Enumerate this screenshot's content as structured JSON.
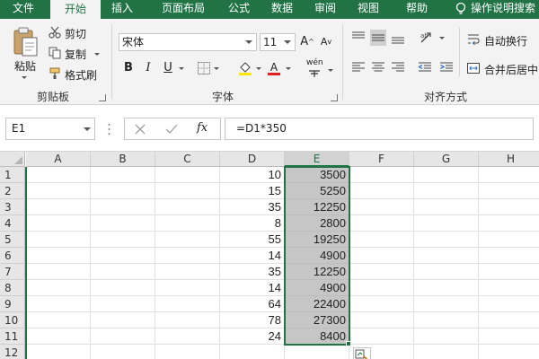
{
  "tabs": [
    "文件",
    "开始",
    "插入",
    "页面布局",
    "公式",
    "数据",
    "审阅",
    "视图",
    "帮助",
    "操作说明搜索"
  ],
  "active_tab": "开始",
  "clipboard": {
    "paste": "粘贴",
    "cut": "剪切",
    "copy": "复制",
    "format_painter": "格式刷",
    "group_label": "剪贴板"
  },
  "font": {
    "name": "宋体",
    "size": "11",
    "bold": "B",
    "italic": "I",
    "underline": "U",
    "phonetic": "wén",
    "group_label": "字体"
  },
  "alignment": {
    "wrap_text": "自动换行",
    "merge_center": "合并后居中",
    "group_label": "对齐方式"
  },
  "formula_bar": {
    "name_box": "E1",
    "fx": "fx",
    "formula": "=D1*350"
  },
  "columns": [
    "A",
    "B",
    "C",
    "D",
    "E",
    "F",
    "G",
    "H"
  ],
  "selected_column": "E",
  "rows": [
    {
      "num": "1",
      "d": "10",
      "e": "3500"
    },
    {
      "num": "2",
      "d": "15",
      "e": "5250"
    },
    {
      "num": "3",
      "d": "35",
      "e": "12250"
    },
    {
      "num": "4",
      "d": "8",
      "e": "2800"
    },
    {
      "num": "5",
      "d": "55",
      "e": "19250"
    },
    {
      "num": "6",
      "d": "14",
      "e": "4900"
    },
    {
      "num": "7",
      "d": "35",
      "e": "12250"
    },
    {
      "num": "8",
      "d": "14",
      "e": "4900"
    },
    {
      "num": "9",
      "d": "64",
      "e": "22400"
    },
    {
      "num": "10",
      "d": "78",
      "e": "27300"
    },
    {
      "num": "11",
      "d": "24",
      "e": "8400"
    },
    {
      "num": "12",
      "d": "",
      "e": ""
    }
  ],
  "colors": {
    "accent": "#217346",
    "selection_fill": "#c6c6c6",
    "font_color_bar": "#e02020",
    "highlight_bar": "#ffe600"
  }
}
